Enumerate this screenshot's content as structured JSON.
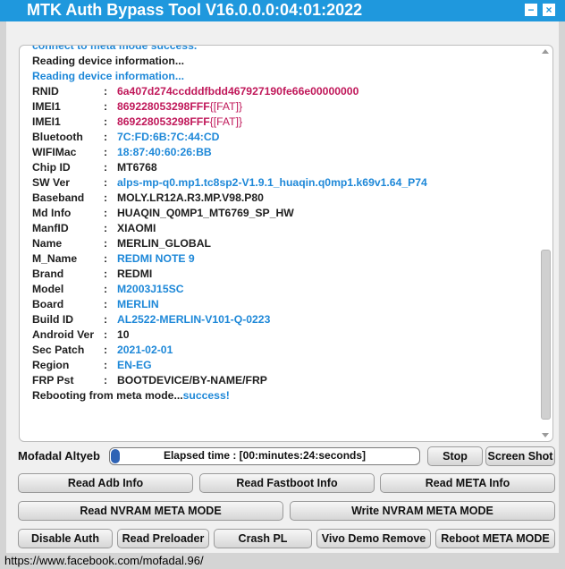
{
  "window": {
    "title": "MTK Auth Bypass Tool V16.0.0.0:04:01:2022",
    "minimize_glyph": "−",
    "close_glyph": "×"
  },
  "log": {
    "partial_line": "connect to meta mode success.",
    "line1": "Reading device information...",
    "line2": "Reading device information...",
    "separator": ":",
    "rows": [
      {
        "label": "RNID",
        "value": "6a407d274ccdddfbdd467927190fe66e00000000",
        "color": "red"
      },
      {
        "label": "IMEI1",
        "value": "869228053298FFF",
        "suffix": "{[FAT]}",
        "color": "red"
      },
      {
        "label": "IMEI1",
        "value": "869228053298FFF",
        "suffix": "{[FAT]}",
        "color": "red"
      },
      {
        "label": "Bluetooth",
        "value": "7C:FD:6B:7C:44:CD",
        "color": "blue"
      },
      {
        "label": "WIFIMac",
        "value": "18:87:40:60:26:BB",
        "color": "blue"
      },
      {
        "label": "Chip ID",
        "value": "MT6768",
        "color": "dark"
      },
      {
        "label": "SW Ver",
        "value": "alps-mp-q0.mp1.tc8sp2-V1.9.1_huaqin.q0mp1.k69v1.64_P74",
        "color": "blue"
      },
      {
        "label": "Baseband",
        "value": "MOLY.LR12A.R3.MP.V98.P80",
        "color": "dark"
      },
      {
        "label": "Md Info",
        "value": "HUAQIN_Q0MP1_MT6769_SP_HW",
        "color": "dark"
      },
      {
        "label": "ManfID",
        "value": "XIAOMI",
        "color": "dark"
      },
      {
        "label": "Name",
        "value": "MERLIN_GLOBAL",
        "color": "dark"
      },
      {
        "label": "M_Name",
        "value": "REDMI NOTE 9",
        "color": "blue"
      },
      {
        "label": "Brand",
        "value": "REDMI",
        "color": "dark"
      },
      {
        "label": "Model",
        "value": "M2003J15SC",
        "color": "blue"
      },
      {
        "label": "Board",
        "value": "MERLIN",
        "color": "blue"
      },
      {
        "label": "Build ID",
        "value": "AL2522-MERLIN-V101-Q-0223",
        "color": "blue"
      },
      {
        "label": "Android Ver",
        "value": "10",
        "color": "dark"
      },
      {
        "label": "Sec Patch",
        "value": "2021-02-01",
        "color": "blue"
      },
      {
        "label": "Region",
        "value": "EN-EG",
        "color": "blue"
      },
      {
        "label": "FRP Pst",
        "value": "BOOTDEVICE/BY-NAME/FRP",
        "color": "dark"
      }
    ],
    "last_line_prefix": "Rebooting from meta mode...",
    "last_line_status": "success!"
  },
  "progress": {
    "owner_label": "Mofadal Altyeb",
    "elapsed_text": "Elapsed time : [00:minutes:24:seconds]",
    "fraction": 0.03
  },
  "buttons": {
    "stop": "Stop",
    "screenshot": "Screen Shot",
    "read_adb": "Read Adb Info",
    "read_fastboot": "Read Fastboot Info",
    "read_meta": "Read META Info",
    "read_nvram": "Read NVRAM META MODE",
    "write_nvram": "Write NVRAM META MODE",
    "disable_auth": "Disable Auth",
    "read_preloader": "Read Preloader",
    "crash_pl": "Crash PL",
    "vivo_demo": "Vivo Demo Remove",
    "reboot_meta": "Reboot META MODE"
  },
  "status_bar": {
    "link": "https://www.facebook.com/mofadal.96/"
  },
  "colors": {
    "title_bar": "#1f98dd",
    "blue_text": "#1e88d8",
    "red_text": "#c0185a",
    "progress_fill": "#2f63b5"
  }
}
